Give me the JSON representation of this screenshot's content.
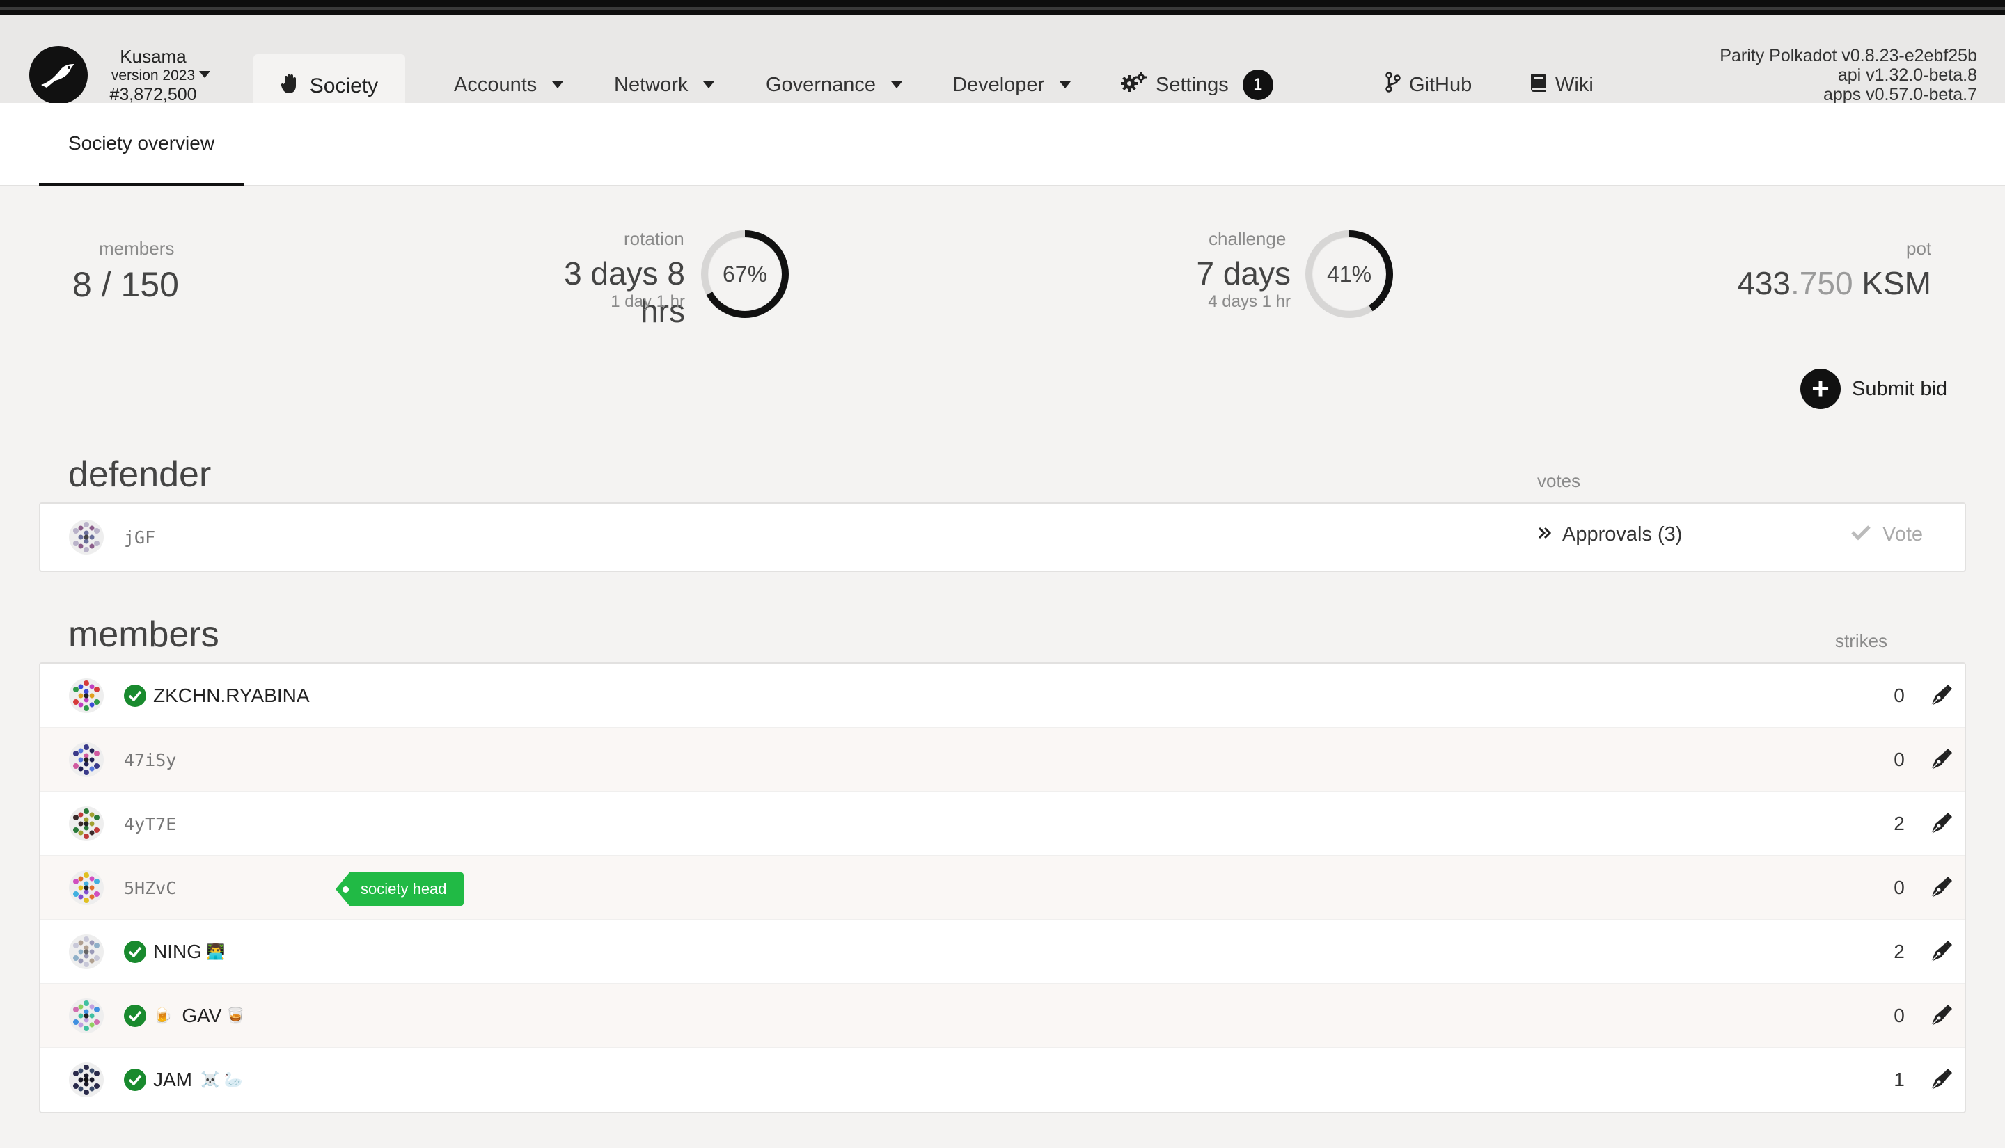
{
  "chain": {
    "name": "Kusama",
    "version": "version 2023",
    "block": "#3,872,500"
  },
  "nav": {
    "active_tab": "Society",
    "items": [
      {
        "label": "Accounts"
      },
      {
        "label": "Network"
      },
      {
        "label": "Governance"
      },
      {
        "label": "Developer"
      },
      {
        "label": "Settings",
        "badge": "1"
      },
      {
        "label": "GitHub"
      },
      {
        "label": "Wiki"
      }
    ]
  },
  "build": {
    "line1": "Parity Polkadot v0.8.23-e2ebf25b",
    "line2": "api v1.32.0-beta.8",
    "line3": "apps v0.57.0-beta.7"
  },
  "subnav": {
    "tab": "Society overview"
  },
  "summary": {
    "members_label": "members",
    "members_value": "8 / 150",
    "rotation_label": "rotation",
    "rotation_value": "3 days 8 hrs",
    "rotation_sub": "1 day 1 hr",
    "rotation_percent_text": "67%",
    "rotation_progress": 0.67,
    "challenge_label": "challenge",
    "challenge_value": "7 days",
    "challenge_sub": "4 days 1 hr",
    "challenge_percent_text": "41%",
    "challenge_progress": 0.41,
    "pot_label": "pot",
    "pot_int": "433",
    "pot_frac": ".750",
    "pot_unit": "KSM"
  },
  "actions": {
    "submit_bid": "Submit bid"
  },
  "defender": {
    "title": "defender",
    "votes_header": "votes",
    "address": "jGF",
    "approvals": "Approvals (3)",
    "vote_label": "Vote"
  },
  "members": {
    "title": "members",
    "strikes_header": "strikes",
    "head_tag": "society head",
    "rows": [
      {
        "name": "ZKCHN.RYABINA",
        "verified": true,
        "mono": false,
        "strikes": "0"
      },
      {
        "name": "47iSy",
        "verified": false,
        "mono": true,
        "strikes": "0"
      },
      {
        "name": "4yT7E",
        "verified": false,
        "mono": true,
        "strikes": "2"
      },
      {
        "name": "5HZvC",
        "verified": false,
        "mono": true,
        "strikes": "0",
        "head": true
      },
      {
        "name": "NING",
        "verified": true,
        "mono": false,
        "strikes": "2",
        "suffix": "👨‍💻"
      },
      {
        "name": "GAV",
        "verified": true,
        "mono": false,
        "strikes": "0",
        "prefix": "🍺",
        "suffix": "🥃"
      },
      {
        "name": "JAM",
        "verified": true,
        "mono": false,
        "strikes": "1",
        "suffix": "☠️ 🦢"
      }
    ]
  },
  "colors": {
    "accent_dark": "#111111",
    "verified_green": "#198a2e",
    "tag_green": "#21ba45"
  }
}
